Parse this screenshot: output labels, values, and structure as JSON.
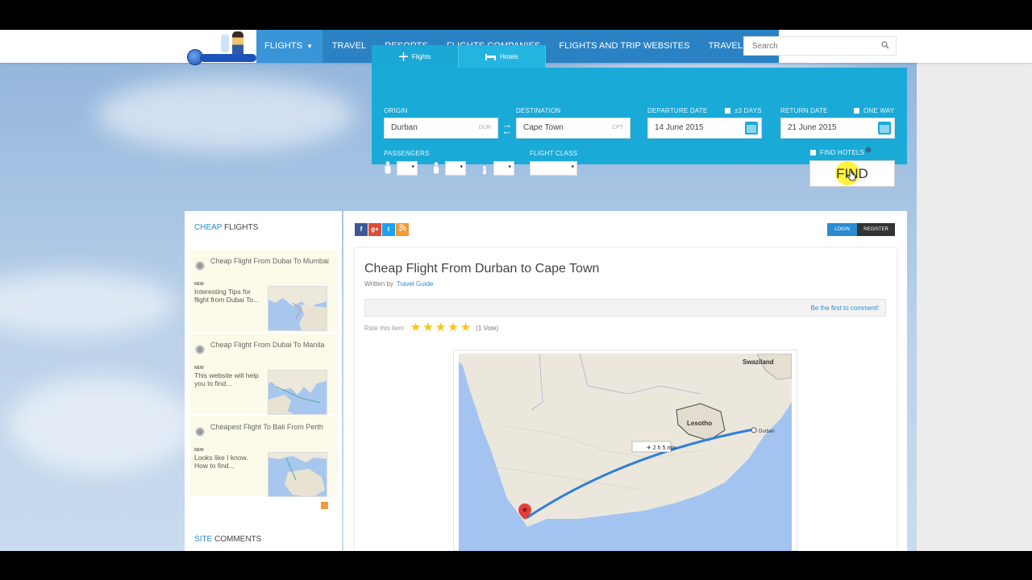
{
  "nav": {
    "items": [
      "FLIGHTS",
      "TRAVEL",
      "RESORTS",
      "FLIGHTS COMPANIES",
      "FLIGHTS AND TRIP WEBSITES",
      "TRAVEL BLOG"
    ],
    "search_placeholder": "Search"
  },
  "booking": {
    "tabs": [
      "Flights",
      "Hotels"
    ],
    "origin_label": "ORIGIN",
    "origin_value": "Durban",
    "origin_code": "DUR",
    "destination_label": "DESTINATION",
    "destination_value": "Cape Town",
    "destination_code": "CPT",
    "departure_label": "DEPARTURE DATE",
    "flex_label": "±3 DAYS",
    "departure_value": "14 June 2015",
    "return_label": "RETURN DATE",
    "one_way_label": "ONE WAY",
    "return_value": "21 June 2015",
    "passengers_label": "PASSENGERS",
    "flight_class_label": "FLIGHT CLASS",
    "find_hotels_label": "FIND HOTELS",
    "find_button": "FIND"
  },
  "sidebar": {
    "title_accent": "CHEAP",
    "title_rest": " FLIGHTS",
    "items": [
      {
        "title": "Cheap Flight From Dubai To Mumbai",
        "badge": "NEW",
        "excerpt": "Interesting Tips for flight from Dubai To..."
      },
      {
        "title": "Cheap Flight From Dubai To Manila",
        "badge": "NEW",
        "excerpt": "This website will help you to find..."
      },
      {
        "title": "Cheapest Flight To Bali From Perth",
        "badge": "NEW",
        "excerpt": "Looks like I know. How to find..."
      }
    ],
    "comments_accent": "SITE",
    "comments_rest": " COMMENTS"
  },
  "header_actions": {
    "login": "LOGIN",
    "register": "REGISTER"
  },
  "social": [
    "f",
    "g+",
    "t",
    "rss"
  ],
  "article": {
    "title": "Cheap Flight From Durban to Cape Town",
    "written_by": "Written by",
    "author": "Travel Guide",
    "comment_link": "Be the first to comment!",
    "rate_label": "Rate this item",
    "rating": 5,
    "votes": "(1 Vote)"
  },
  "map": {
    "labels": [
      "Swaziland",
      "Lesotho",
      "Durban",
      "2 h 5 min"
    ]
  },
  "colors": {
    "nav_blue": "#2a82c4",
    "widget_cyan": "#1aaad8",
    "link_blue": "#2a8bd0",
    "star_yellow": "#f5c518"
  }
}
